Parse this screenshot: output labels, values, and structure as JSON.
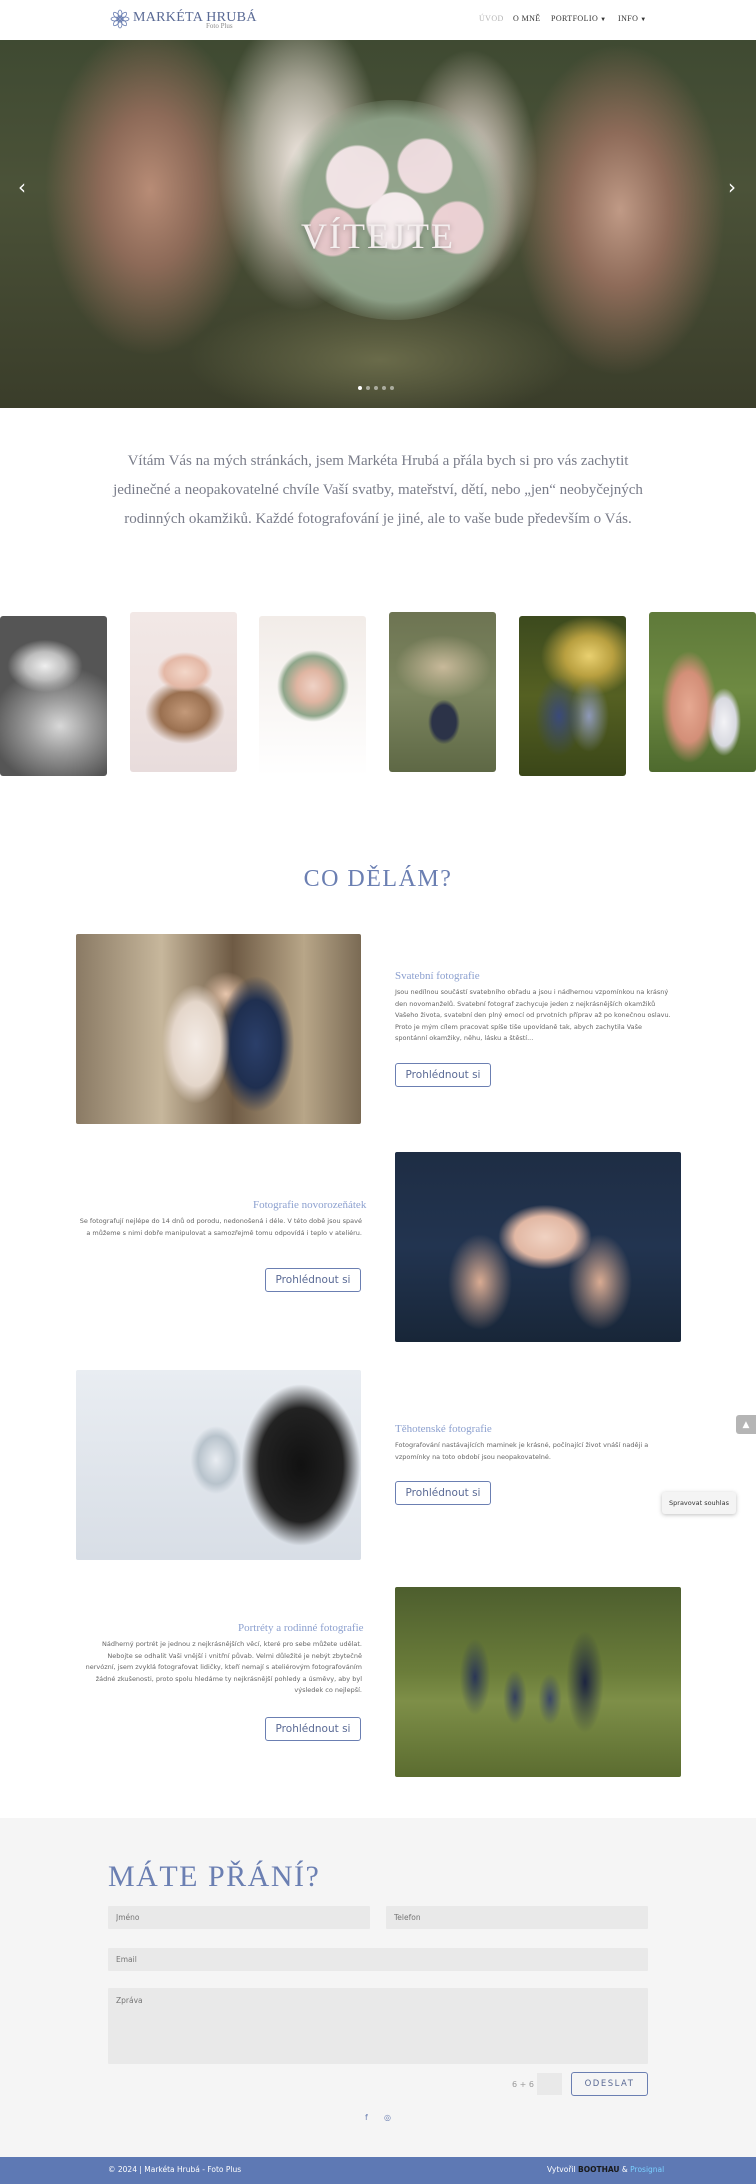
{
  "header": {
    "logo_name": "MARKÉTA HRUBÁ",
    "logo_sub": "Foto Plus",
    "nav": [
      {
        "label": "ÚVOD",
        "active": true
      },
      {
        "label": "O MNĚ"
      },
      {
        "label": "PORTFOLIO",
        "dropdown": true
      },
      {
        "label": "INFO",
        "dropdown": true
      }
    ]
  },
  "hero": {
    "title": "VÍTEJTE",
    "prev_arrow": "‹",
    "next_arrow": "›",
    "slide_count": 5,
    "active_slide": 1
  },
  "intro": {
    "text": "Vítám Vás na mých stránkách, jsem Markéta Hrubá a přála bych si pro vás zachytit jedinečné a neopakovatelné chvíle Vaší svatby, mateřství, dětí, nebo „jen“ neobyčejných rodinných okamžiků. Každé fotografování je jiné, ale to vaše bude především o Vás."
  },
  "gallery": [
    {
      "subject": "newborn with headband, black and white"
    },
    {
      "subject": "newborn in basket with flowers"
    },
    {
      "subject": "wedding bouquet"
    },
    {
      "subject": "couple on bench in park"
    },
    {
      "subject": "couple kissing at sunset"
    },
    {
      "subject": "maternity with child"
    }
  ],
  "services": {
    "title": "CO DĚLÁM?",
    "items": [
      {
        "heading": "Svatební fotografie",
        "text": "Jsou nedílnou součástí svatebního obřadu a jsou i nádhernou vzpomínkou na krásný den novomanželů. Svatební fotograf zachycuje jeden z nejkrásnějších okamžiků Vašeho života, svatební den plný emocí od prvotních příprav až po konečnou oslavu. Proto je mým cílem pracovat spíše tiše upovídaně tak, abych zachytila Vaše spontánní okamžiky, něhu, lásku a štěstí...",
        "button": "Prohlédnout si"
      },
      {
        "heading": "Fotografie novorozeňátek",
        "text": "Se fotografují nejlépe do 14 dnů od porodu, nedonošená i déle. V této době jsou spavé a můžeme s nimi dobře manipulovat a samozřejmě tomu odpovídá i teplo v ateliéru.",
        "button": "Prohlédnout si"
      },
      {
        "heading": "Těhotenské fotografie",
        "text": "Fotografování nastávajících maminek je krásné, počínající život vnáší naději a vzpomínky na toto období jsou neopakovatelné.",
        "button": "Prohlédnout si"
      },
      {
        "heading": "Portréty a rodinné fotografie",
        "text": "Nádherný portrét je jednou z nejkrásnějších věcí, které pro sebe můžete udělat. Nebojte se odhalit Vaši vnější i vnitřní půvab. Velmi důležité je nebýt zbytečně nervózní, jsem zvyklá fotografovat lidičky, kteří nemají s ateliérovým fotografováním žádné zkušenosti, proto spolu hledáme ty nejkrásnější pohledy a úsměvy, aby byl výsledek co nejlepší.",
        "button": "Prohlédnout si"
      }
    ]
  },
  "floating": {
    "scroll_top": "▲",
    "consent": "Spravovat souhlas"
  },
  "contact": {
    "title": "MÁTE PŘÁNÍ?",
    "name_placeholder": "Jméno",
    "phone_placeholder": "Telefon",
    "email_placeholder": "Email",
    "message_placeholder": "Zpráva",
    "captcha": "6 + 6 =",
    "send": "ODESLAT",
    "social": [
      "f",
      "◎"
    ]
  },
  "footer": {
    "left": "© 2024 | Markéta Hrubá - Foto Plus",
    "right_prefix": "Vytvořil ",
    "brand1": "BOOTHAU",
    "amp": " & ",
    "brand2": "Prosignal"
  }
}
